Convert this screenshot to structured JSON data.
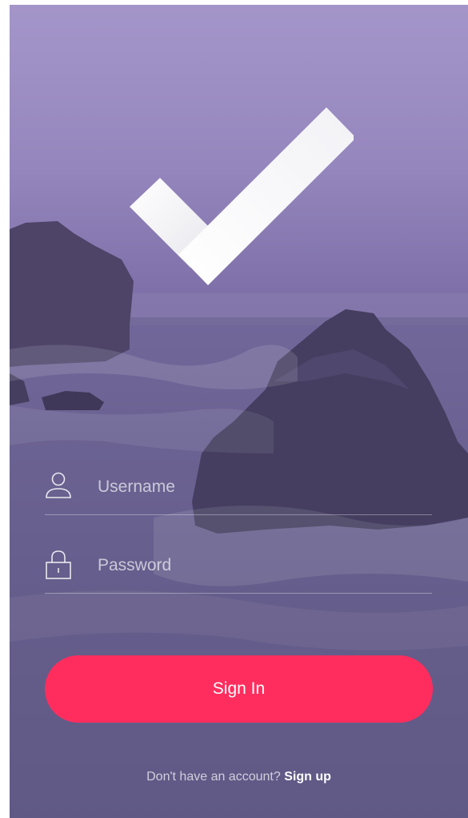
{
  "login": {
    "username_placeholder": "Username",
    "password_placeholder": "Password",
    "signin_label": "Sign In",
    "signup_prompt": "Don't have an account?",
    "signup_link": "Sign up"
  },
  "icons": {
    "logo": "checkmark-logo",
    "username": "user-icon",
    "password": "lock-icon"
  },
  "colors": {
    "accent": "#ff2d5e",
    "overlay_top": "#a495c9",
    "overlay_bottom": "#564f7a"
  }
}
